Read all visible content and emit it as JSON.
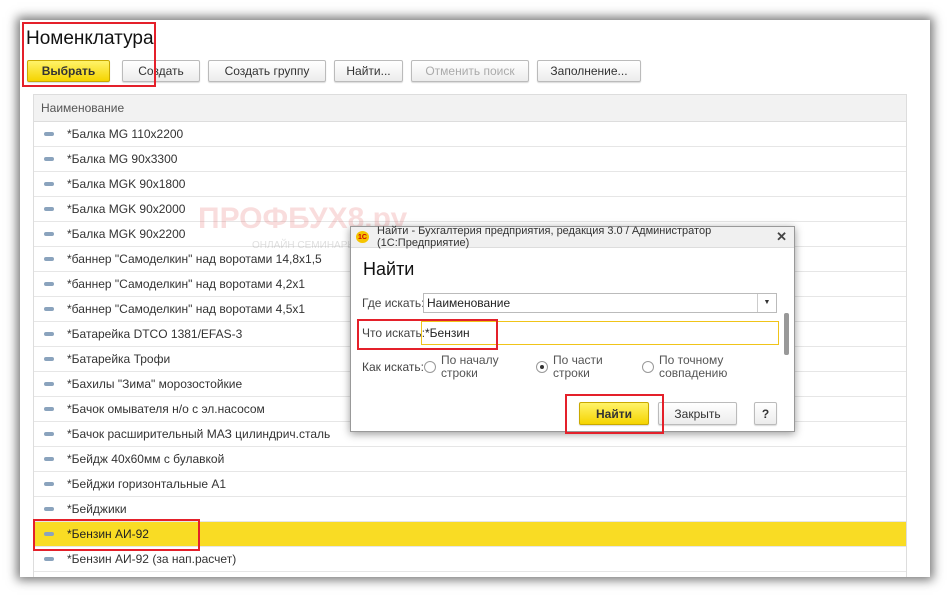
{
  "page": {
    "title": "Номенклатура"
  },
  "toolbar": {
    "select": "Выбрать",
    "create": "Создать",
    "create_group": "Создать группу",
    "find": "Найти...",
    "cancel_search": "Отменить поиск",
    "fill": "Заполнение..."
  },
  "table": {
    "header": "Наименование",
    "rows": [
      "*Балка MG 110x2200",
      "*Балка MG 90x3300",
      "*Балка MGK 90x1800",
      "*Балка MGK 90x2000",
      "*Балка MGK 90x2200",
      "*баннер \"Самоделкин\" над воротами 14,8х1,5",
      "*баннер \"Самоделкин\" над воротами 4,2х1",
      "*баннер \"Самоделкин\" над воротами 4,5х1",
      "*Батарейка DTCO 1381/EFAS-3",
      "*Батарейка Трофи",
      "*Бахилы \"Зима\" морозостойкие",
      "*Бачок омывателя н/о с эл.насосом",
      "*Бачок расширительный МАЗ цилиндрич.сталь",
      "*Бейдж 40х60мм с булавкой",
      "*Бейджи горизонтальные А1",
      "*Бейджики",
      "*Бензин АИ-92",
      "*Бензин АИ-92 (за нап.расчет)"
    ],
    "selected_index": 16
  },
  "watermark": {
    "text": "ПРОФБУХ8.ру",
    "sub": "ОНЛАЙН СЕМИНАРЫ И ВИДЕОКУРСЫ 1С:8"
  },
  "dialog": {
    "window_title": "Найти - Бухгалтерия предприятия, редакция 3.0 / Администратор  (1С:Предприятие)",
    "logo": "1С",
    "title": "Найти",
    "where_label": "Где искать:",
    "where_value": "Наименование",
    "what_label": "Что искать:",
    "what_value": "*Бензин",
    "how_label": "Как искать:",
    "options": [
      "По началу строки",
      "По части строки",
      "По точному совпадению"
    ],
    "options_l1": [
      "По началу",
      "По части",
      "По точному"
    ],
    "options_l2": [
      "строки",
      "строки",
      "совпадению"
    ],
    "selected_option": 1,
    "find": "Найти",
    "close": "Закрыть",
    "help": "?"
  },
  "colors": {
    "accent": "#f9dc24",
    "highlight": "#e4202a"
  }
}
